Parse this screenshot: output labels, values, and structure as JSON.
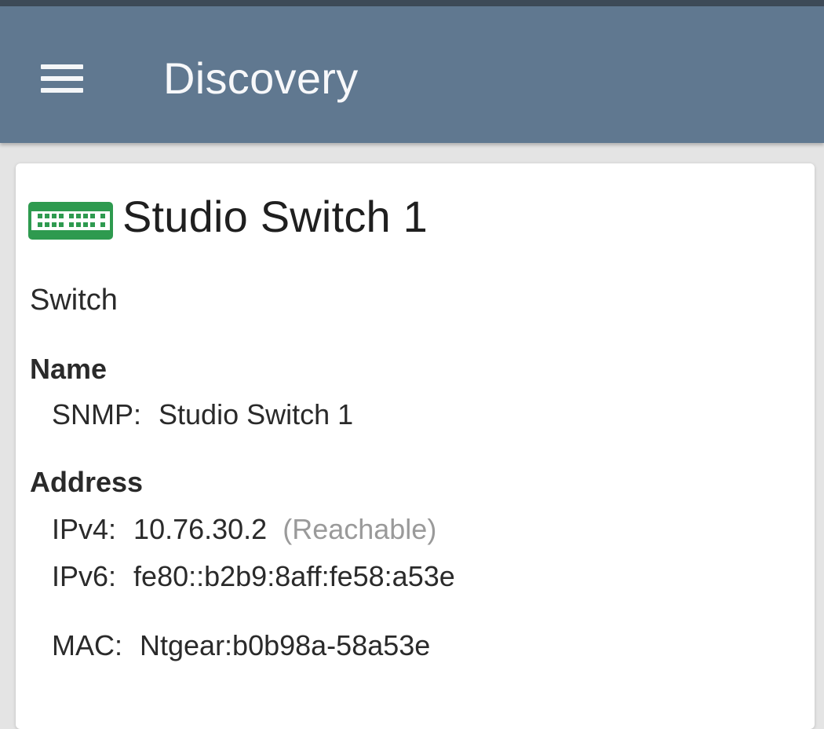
{
  "app_bar": {
    "title": "Discovery",
    "menu_icon": "hamburger-menu-icon"
  },
  "device": {
    "icon": "network-switch-icon",
    "icon_color": "#2e9a4f",
    "name": "Studio Switch 1",
    "type": "Switch"
  },
  "name_section": {
    "heading": "Name",
    "snmp_label": "SNMP:",
    "snmp_value": "Studio Switch 1"
  },
  "address_section": {
    "heading": "Address",
    "ipv4_label": "IPv4:",
    "ipv4_value": "10.76.30.2",
    "ipv4_status": "(Reachable)",
    "ipv6_label": "IPv6:",
    "ipv6_value": "fe80::b2b9:8aff:fe58:a53e",
    "mac_label": "MAC:",
    "mac_value": "Ntgear:b0b98a-58a53e"
  },
  "colors": {
    "app_bar": "#607890",
    "status_strip": "#3d4a57",
    "background": "#e4e4e4",
    "card": "#ffffff",
    "muted_text": "#9a9a9a"
  }
}
